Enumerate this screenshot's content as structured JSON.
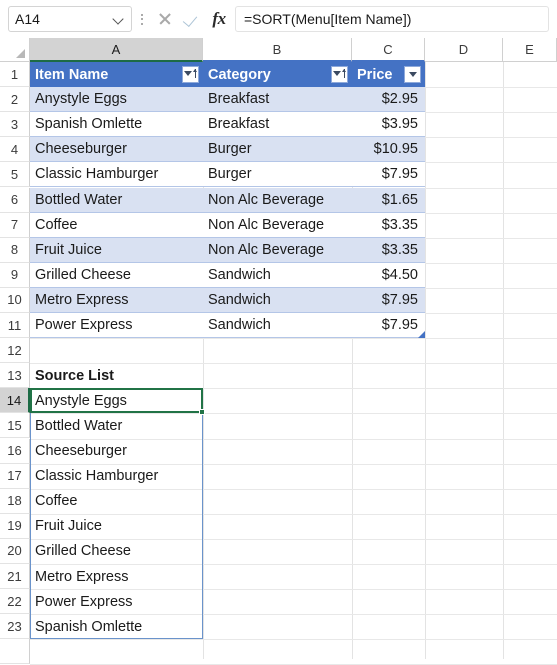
{
  "formula_bar": {
    "name_box_value": "A14",
    "name_box_dropdown_icon": "chevron-down-icon",
    "more_icon": "vertical-dots-icon",
    "cancel_icon": "cancel-x-icon",
    "enter_icon": "enter-check-icon",
    "insert_function_icon": "fx-icon",
    "insert_function_label": "fx",
    "formula_value": "=SORT(Menu[Item Name])",
    "formula_placeholder": ""
  },
  "grid": {
    "column_headers": [
      "A",
      "B",
      "C",
      "D",
      "E"
    ],
    "active_column": "A",
    "active_row": 14,
    "row_numbers": [
      1,
      2,
      3,
      4,
      5,
      6,
      7,
      8,
      9,
      10,
      11,
      12,
      13,
      14,
      15,
      16,
      17,
      18,
      19,
      20,
      21,
      22,
      23
    ],
    "selected_cell": "A14"
  },
  "table": {
    "name": "Menu",
    "header_row": 1,
    "headers": [
      {
        "label": "Item Name",
        "filter_icon": "sort-filter-icon"
      },
      {
        "label": "Category",
        "filter_icon": "sort-filter-icon"
      },
      {
        "label": "Price",
        "filter_icon": "filter-dropdown-icon"
      }
    ],
    "rows": [
      {
        "row": 2,
        "item": "Anystyle Eggs",
        "category": "Breakfast",
        "price": "$2.95",
        "banded": true
      },
      {
        "row": 3,
        "item": "Spanish Omlette",
        "category": "Breakfast",
        "price": "$3.95",
        "banded": false
      },
      {
        "row": 4,
        "item": "Cheeseburger",
        "category": "Burger",
        "price": "$10.95",
        "banded": true
      },
      {
        "row": 5,
        "item": "Classic Hamburger",
        "category": "Burger",
        "price": "$7.95",
        "banded": false
      },
      {
        "row": 6,
        "item": "Bottled Water",
        "category": "Non Alc Beverage",
        "price": "$1.65",
        "banded": true
      },
      {
        "row": 7,
        "item": "Coffee",
        "category": "Non Alc Beverage",
        "price": "$3.35",
        "banded": false
      },
      {
        "row": 8,
        "item": "Fruit Juice",
        "category": "Non Alc Beverage",
        "price": "$3.35",
        "banded": true
      },
      {
        "row": 9,
        "item": "Grilled Cheese",
        "category": "Sandwich",
        "price": "$4.50",
        "banded": false
      },
      {
        "row": 10,
        "item": "Metro Express",
        "category": "Sandwich",
        "price": "$7.95",
        "banded": true
      },
      {
        "row": 11,
        "item": "Power Express",
        "category": "Sandwich",
        "price": "$7.95",
        "banded": false
      }
    ],
    "resize_handle_icon": "table-resize-handle-icon"
  },
  "source_list": {
    "title_row": 13,
    "title": "Source List",
    "first_row": 14,
    "items": [
      "Anystyle Eggs",
      "Bottled Water",
      "Cheeseburger",
      "Classic Hamburger",
      "Coffee",
      "Fruit Juice",
      "Grilled Cheese",
      "Metro Express",
      "Power Express",
      "Spanish Omlette"
    ]
  },
  "colors": {
    "table_header_blue": "#4472C4",
    "table_band_blue": "#D9E1F2",
    "selection_green": "#217346",
    "spill_border_blue": "#6A93CB"
  }
}
